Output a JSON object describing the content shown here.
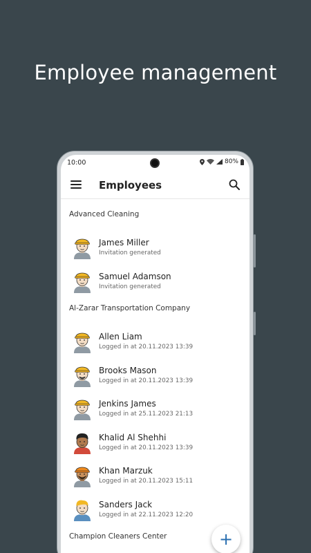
{
  "promo": {
    "title": "Employee management"
  },
  "status_bar": {
    "time": "10:00",
    "battery": "80%"
  },
  "app_bar": {
    "title": "Employees"
  },
  "groups": [
    {
      "name": "Advanced Cleaning",
      "employees": [
        {
          "name": "James Miller",
          "status": "Invitation generated",
          "avatar": "worker-yellow-helmet"
        },
        {
          "name": "Samuel Adamson",
          "status": "Invitation generated",
          "avatar": "worker-yellow-helmet"
        }
      ]
    },
    {
      "name": "Al-Zarar Transportation Company",
      "employees": [
        {
          "name": "Allen Liam",
          "status": "Logged in at 20.11.2023 13:39",
          "avatar": "worker-yellow-helmet"
        },
        {
          "name": "Brooks Mason",
          "status": "Logged in at 20.11.2023 13:39",
          "avatar": "worker-yellow-helmet-beard"
        },
        {
          "name": "Jenkins James",
          "status": "Logged in at 25.11.2023 21:13",
          "avatar": "worker-yellow-helmet"
        },
        {
          "name": "Khalid Al Shehhi",
          "status": "Logged in at 20.11.2023 13:39",
          "avatar": "worker-dark-hair"
        },
        {
          "name": "Khan Marzuk",
          "status": "Logged in at 20.11.2023 15:11",
          "avatar": "worker-orange-helmet-beard"
        },
        {
          "name": "Sanders Jack",
          "status": "Logged in at 22.11.2023 12:20",
          "avatar": "worker-blonde-hair"
        }
      ]
    },
    {
      "name": "Champion Cleaners Center",
      "employees": []
    }
  ],
  "fab": {
    "label": "+"
  },
  "colors": {
    "background": "#3a464c",
    "accent": "#2a6fb0",
    "helmet": "#f2b824"
  }
}
